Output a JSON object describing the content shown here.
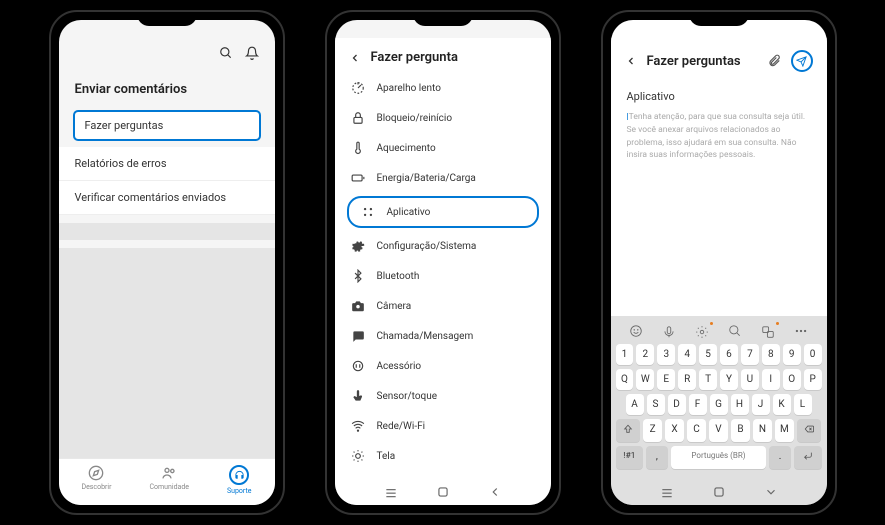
{
  "phone1": {
    "section_title": "Enviar comentários",
    "items": [
      {
        "label": "Fazer perguntas",
        "highlighted": true
      },
      {
        "label": "Relatórios de erros",
        "highlighted": false
      },
      {
        "label": "Verificar comentários enviados",
        "highlighted": false
      }
    ],
    "bottom_nav": [
      {
        "label": "Descobrir",
        "icon": "compass-icon",
        "active": false
      },
      {
        "label": "Comunidade",
        "icon": "people-icon",
        "active": false
      },
      {
        "label": "Suporte",
        "icon": "headset-icon",
        "active": true
      }
    ]
  },
  "phone2": {
    "header_title": "Fazer pergunta",
    "categories": [
      {
        "label": "Aparelho lento",
        "icon": "speed-icon",
        "highlighted": false
      },
      {
        "label": "Bloqueio/reinício",
        "icon": "lock-icon",
        "highlighted": false
      },
      {
        "label": "Aquecimento",
        "icon": "thermometer-icon",
        "highlighted": false
      },
      {
        "label": "Energia/Bateria/Carga",
        "icon": "battery-icon",
        "highlighted": false
      },
      {
        "label": "Aplicativo",
        "icon": "apps-icon",
        "highlighted": true
      },
      {
        "label": "Configuração/Sistema",
        "icon": "gear-icon",
        "highlighted": false
      },
      {
        "label": "Bluetooth",
        "icon": "bluetooth-icon",
        "highlighted": false
      },
      {
        "label": "Câmera",
        "icon": "camera-icon",
        "highlighted": false
      },
      {
        "label": "Chamada/Mensagem",
        "icon": "message-icon",
        "highlighted": false
      },
      {
        "label": "Acessório",
        "icon": "plug-icon",
        "highlighted": false
      },
      {
        "label": "Sensor/toque",
        "icon": "touch-icon",
        "highlighted": false
      },
      {
        "label": "Rede/Wi-Fi",
        "icon": "wifi-icon",
        "highlighted": false
      },
      {
        "label": "Tela",
        "icon": "brightness-icon",
        "highlighted": false
      }
    ]
  },
  "phone3": {
    "header_title": "Fazer perguntas",
    "category": "Aplicativo",
    "placeholder": "Tenha atenção, para que sua consulta seja útil. Se você anexar arquivos relacionados ao problema, isso ajudará em sua consulta. Não insira suas informações pessoais.",
    "keyboard": {
      "row_num": [
        "1",
        "2",
        "3",
        "4",
        "5",
        "6",
        "7",
        "8",
        "9",
        "0"
      ],
      "row1": [
        "Q",
        "W",
        "E",
        "R",
        "T",
        "Y",
        "U",
        "I",
        "O",
        "P"
      ],
      "row2": [
        "A",
        "S",
        "D",
        "F",
        "G",
        "H",
        "J",
        "K",
        "L"
      ],
      "row3": [
        "Z",
        "X",
        "C",
        "V",
        "B",
        "N",
        "M"
      ],
      "space_label": "Português (BR)",
      "num_key": "!#1"
    }
  }
}
